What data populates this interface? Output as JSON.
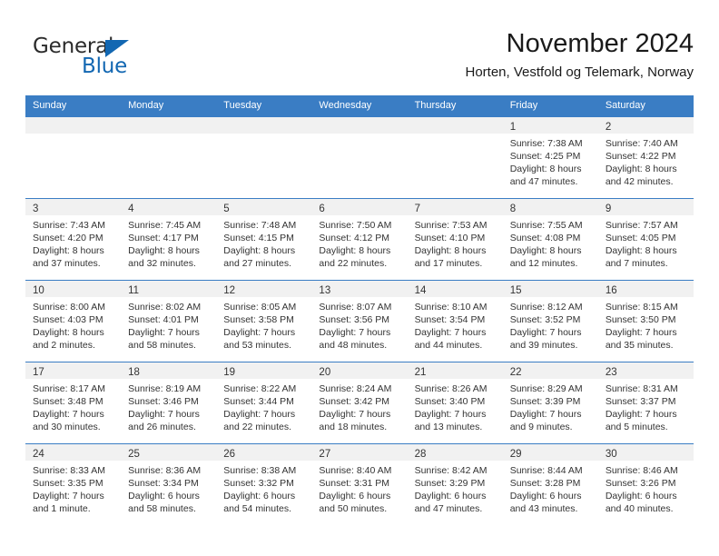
{
  "brand": {
    "name_part1": "General",
    "name_part2": "Blue",
    "accent_color": "#1267b2"
  },
  "header": {
    "title": "November 2024",
    "subtitle": "Horten, Vestfold og Telemark, Norway"
  },
  "theme": {
    "header_row_bg": "#3a7dc4",
    "daynum_band_bg": "#f1f1f1",
    "text_color": "#333333"
  },
  "weekdays": [
    "Sunday",
    "Monday",
    "Tuesday",
    "Wednesday",
    "Thursday",
    "Friday",
    "Saturday"
  ],
  "weeks": [
    [
      {
        "day": "",
        "lines": []
      },
      {
        "day": "",
        "lines": []
      },
      {
        "day": "",
        "lines": []
      },
      {
        "day": "",
        "lines": []
      },
      {
        "day": "",
        "lines": []
      },
      {
        "day": "1",
        "lines": [
          "Sunrise: 7:38 AM",
          "Sunset: 4:25 PM",
          "Daylight: 8 hours",
          "and 47 minutes."
        ]
      },
      {
        "day": "2",
        "lines": [
          "Sunrise: 7:40 AM",
          "Sunset: 4:22 PM",
          "Daylight: 8 hours",
          "and 42 minutes."
        ]
      }
    ],
    [
      {
        "day": "3",
        "lines": [
          "Sunrise: 7:43 AM",
          "Sunset: 4:20 PM",
          "Daylight: 8 hours",
          "and 37 minutes."
        ]
      },
      {
        "day": "4",
        "lines": [
          "Sunrise: 7:45 AM",
          "Sunset: 4:17 PM",
          "Daylight: 8 hours",
          "and 32 minutes."
        ]
      },
      {
        "day": "5",
        "lines": [
          "Sunrise: 7:48 AM",
          "Sunset: 4:15 PM",
          "Daylight: 8 hours",
          "and 27 minutes."
        ]
      },
      {
        "day": "6",
        "lines": [
          "Sunrise: 7:50 AM",
          "Sunset: 4:12 PM",
          "Daylight: 8 hours",
          "and 22 minutes."
        ]
      },
      {
        "day": "7",
        "lines": [
          "Sunrise: 7:53 AM",
          "Sunset: 4:10 PM",
          "Daylight: 8 hours",
          "and 17 minutes."
        ]
      },
      {
        "day": "8",
        "lines": [
          "Sunrise: 7:55 AM",
          "Sunset: 4:08 PM",
          "Daylight: 8 hours",
          "and 12 minutes."
        ]
      },
      {
        "day": "9",
        "lines": [
          "Sunrise: 7:57 AM",
          "Sunset: 4:05 PM",
          "Daylight: 8 hours",
          "and 7 minutes."
        ]
      }
    ],
    [
      {
        "day": "10",
        "lines": [
          "Sunrise: 8:00 AM",
          "Sunset: 4:03 PM",
          "Daylight: 8 hours",
          "and 2 minutes."
        ]
      },
      {
        "day": "11",
        "lines": [
          "Sunrise: 8:02 AM",
          "Sunset: 4:01 PM",
          "Daylight: 7 hours",
          "and 58 minutes."
        ]
      },
      {
        "day": "12",
        "lines": [
          "Sunrise: 8:05 AM",
          "Sunset: 3:58 PM",
          "Daylight: 7 hours",
          "and 53 minutes."
        ]
      },
      {
        "day": "13",
        "lines": [
          "Sunrise: 8:07 AM",
          "Sunset: 3:56 PM",
          "Daylight: 7 hours",
          "and 48 minutes."
        ]
      },
      {
        "day": "14",
        "lines": [
          "Sunrise: 8:10 AM",
          "Sunset: 3:54 PM",
          "Daylight: 7 hours",
          "and 44 minutes."
        ]
      },
      {
        "day": "15",
        "lines": [
          "Sunrise: 8:12 AM",
          "Sunset: 3:52 PM",
          "Daylight: 7 hours",
          "and 39 minutes."
        ]
      },
      {
        "day": "16",
        "lines": [
          "Sunrise: 8:15 AM",
          "Sunset: 3:50 PM",
          "Daylight: 7 hours",
          "and 35 minutes."
        ]
      }
    ],
    [
      {
        "day": "17",
        "lines": [
          "Sunrise: 8:17 AM",
          "Sunset: 3:48 PM",
          "Daylight: 7 hours",
          "and 30 minutes."
        ]
      },
      {
        "day": "18",
        "lines": [
          "Sunrise: 8:19 AM",
          "Sunset: 3:46 PM",
          "Daylight: 7 hours",
          "and 26 minutes."
        ]
      },
      {
        "day": "19",
        "lines": [
          "Sunrise: 8:22 AM",
          "Sunset: 3:44 PM",
          "Daylight: 7 hours",
          "and 22 minutes."
        ]
      },
      {
        "day": "20",
        "lines": [
          "Sunrise: 8:24 AM",
          "Sunset: 3:42 PM",
          "Daylight: 7 hours",
          "and 18 minutes."
        ]
      },
      {
        "day": "21",
        "lines": [
          "Sunrise: 8:26 AM",
          "Sunset: 3:40 PM",
          "Daylight: 7 hours",
          "and 13 minutes."
        ]
      },
      {
        "day": "22",
        "lines": [
          "Sunrise: 8:29 AM",
          "Sunset: 3:39 PM",
          "Daylight: 7 hours",
          "and 9 minutes."
        ]
      },
      {
        "day": "23",
        "lines": [
          "Sunrise: 8:31 AM",
          "Sunset: 3:37 PM",
          "Daylight: 7 hours",
          "and 5 minutes."
        ]
      }
    ],
    [
      {
        "day": "24",
        "lines": [
          "Sunrise: 8:33 AM",
          "Sunset: 3:35 PM",
          "Daylight: 7 hours",
          "and 1 minute."
        ]
      },
      {
        "day": "25",
        "lines": [
          "Sunrise: 8:36 AM",
          "Sunset: 3:34 PM",
          "Daylight: 6 hours",
          "and 58 minutes."
        ]
      },
      {
        "day": "26",
        "lines": [
          "Sunrise: 8:38 AM",
          "Sunset: 3:32 PM",
          "Daylight: 6 hours",
          "and 54 minutes."
        ]
      },
      {
        "day": "27",
        "lines": [
          "Sunrise: 8:40 AM",
          "Sunset: 3:31 PM",
          "Daylight: 6 hours",
          "and 50 minutes."
        ]
      },
      {
        "day": "28",
        "lines": [
          "Sunrise: 8:42 AM",
          "Sunset: 3:29 PM",
          "Daylight: 6 hours",
          "and 47 minutes."
        ]
      },
      {
        "day": "29",
        "lines": [
          "Sunrise: 8:44 AM",
          "Sunset: 3:28 PM",
          "Daylight: 6 hours",
          "and 43 minutes."
        ]
      },
      {
        "day": "30",
        "lines": [
          "Sunrise: 8:46 AM",
          "Sunset: 3:26 PM",
          "Daylight: 6 hours",
          "and 40 minutes."
        ]
      }
    ]
  ]
}
